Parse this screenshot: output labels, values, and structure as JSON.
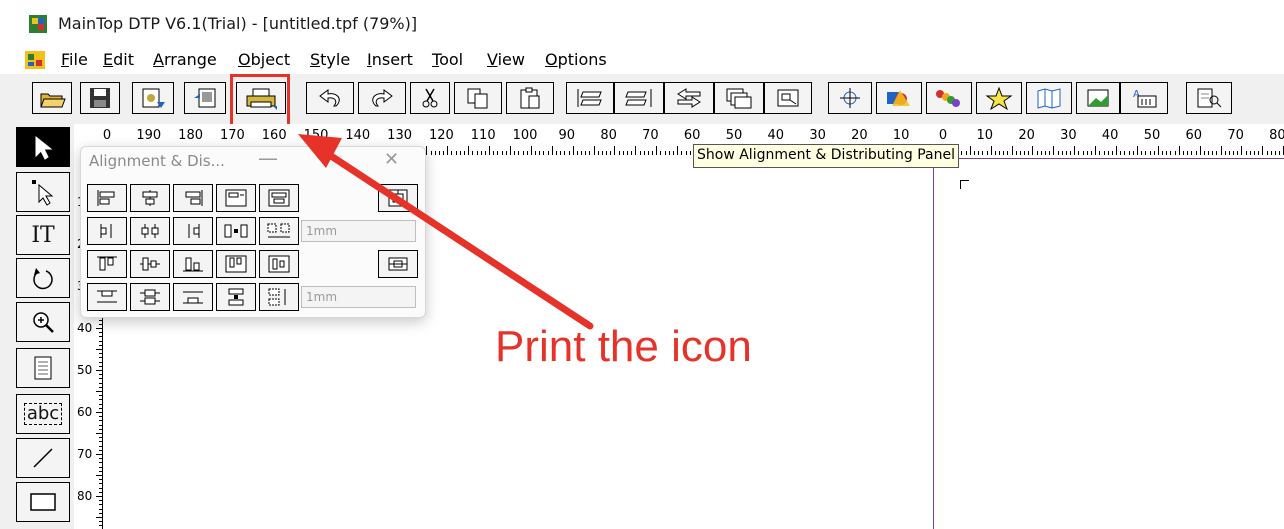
{
  "window": {
    "title": "MainTop DTP V6.1(Trial) - [untitled.tpf (79%)]"
  },
  "menu": [
    {
      "label": "File"
    },
    {
      "label": "Edit"
    },
    {
      "label": "Arrange"
    },
    {
      "label": "Object"
    },
    {
      "label": "Style"
    },
    {
      "label": "Insert"
    },
    {
      "label": "Tool"
    },
    {
      "label": "View"
    },
    {
      "label": "Options"
    }
  ],
  "toolbar": {
    "buttons": [
      "open-icon",
      "save-icon",
      "import-icon",
      "export-icon",
      "print-icon",
      "undo-icon",
      "redo-icon",
      "cut-icon",
      "copy-icon",
      "paste-icon",
      "align-left-icon",
      "align-right-icon",
      "flip-icon",
      "layer-icon",
      "group-icon",
      "crosshair-icon",
      "shapes-icon",
      "color-icon",
      "star-icon",
      "map-icon",
      "image-icon",
      "text-effect-icon",
      "preview-icon"
    ],
    "highlighted": "print-icon"
  },
  "tooltip": "Show Alignment & Distributing Panel",
  "ruler": {
    "top_labels": [
      "0",
      "190",
      "180",
      "170",
      "160",
      "150",
      "140",
      "130",
      "120",
      "110",
      "100",
      "90",
      "80",
      "70",
      "60",
      "50",
      "40",
      "30",
      "20",
      "10",
      "0",
      "10",
      "20",
      "30",
      "40",
      "50",
      "60",
      "70",
      "80"
    ],
    "left_labels": [
      "1",
      "2",
      "3",
      "40",
      "50",
      "60",
      "70",
      "80"
    ]
  },
  "toolbox": [
    {
      "name": "select-arrow-icon"
    },
    {
      "name": "node-select-icon"
    },
    {
      "name": "text-tool",
      "label": "IT"
    },
    {
      "name": "rotate-icon"
    },
    {
      "name": "zoom-icon"
    },
    {
      "name": "page-icon"
    },
    {
      "name": "text-frame-tool",
      "label": "abc"
    },
    {
      "name": "line-icon"
    },
    {
      "name": "rectangle-icon"
    }
  ],
  "panel": {
    "title": "Alignment & Dis...",
    "minimize": "—",
    "close": "✕",
    "spacing_field_1": "1mm",
    "spacing_field_2": "1mm"
  },
  "annotation": {
    "text": "Print the icon",
    "color": "#e63228"
  }
}
